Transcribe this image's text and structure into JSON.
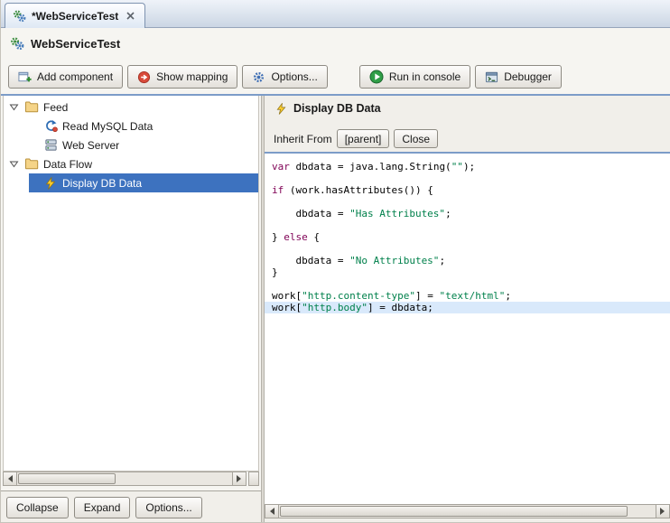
{
  "tab": {
    "title": "*WebServiceTest"
  },
  "header": {
    "title": "WebServiceTest"
  },
  "toolbar": {
    "buttons": [
      {
        "id": "add-component",
        "label": "Add component",
        "icon": "add-component-icon"
      },
      {
        "id": "show-mapping",
        "label": "Show mapping",
        "icon": "show-mapping-icon"
      },
      {
        "id": "options",
        "label": "Options...",
        "icon": "options-gear-icon"
      },
      {
        "id": "run-in-console",
        "label": "Run in console",
        "icon": "run-icon"
      },
      {
        "id": "debugger",
        "label": "Debugger",
        "icon": "debugger-icon"
      }
    ]
  },
  "tree": {
    "items": [
      {
        "label": "Feed",
        "icon": "folder-icon",
        "level": 0,
        "expanded": true
      },
      {
        "label": "Read MySQL Data",
        "icon": "mysql-data-icon",
        "level": 1
      },
      {
        "label": "Web Server",
        "icon": "web-server-icon",
        "level": 1
      },
      {
        "label": "Data Flow",
        "icon": "folder-icon",
        "level": 0,
        "expanded": true
      },
      {
        "label": "Display DB Data",
        "icon": "bolt-icon",
        "level": 1,
        "selected": true
      }
    ],
    "footer": {
      "collapse": "Collapse",
      "expand": "Expand",
      "options": "Options..."
    }
  },
  "editor": {
    "title": "Display DB Data",
    "icon": "bolt-icon",
    "inherit_label": "Inherit From",
    "parent_button": "[parent]",
    "close_button": "Close",
    "code": {
      "current_line": 12,
      "lines": [
        {
          "tokens": [
            {
              "t": "k",
              "v": "var"
            },
            {
              "t": "p",
              "v": " dbdata = java.lang.String("
            },
            {
              "t": "s",
              "v": "\"\""
            },
            {
              "t": "p",
              "v": ");"
            }
          ]
        },
        {
          "tokens": []
        },
        {
          "tokens": [
            {
              "t": "k",
              "v": "if"
            },
            {
              "t": "p",
              "v": " (work.hasAttributes()) {"
            }
          ]
        },
        {
          "tokens": []
        },
        {
          "tokens": [
            {
              "t": "p",
              "v": "    dbdata = "
            },
            {
              "t": "s",
              "v": "\"Has Attributes\""
            },
            {
              "t": "p",
              "v": ";"
            }
          ]
        },
        {
          "tokens": []
        },
        {
          "tokens": [
            {
              "t": "p",
              "v": "} "
            },
            {
              "t": "k",
              "v": "else"
            },
            {
              "t": "p",
              "v": " {"
            }
          ]
        },
        {
          "tokens": []
        },
        {
          "tokens": [
            {
              "t": "p",
              "v": "    dbdata = "
            },
            {
              "t": "s",
              "v": "\"No Attributes\""
            },
            {
              "t": "p",
              "v": ";"
            }
          ]
        },
        {
          "tokens": [
            {
              "t": "p",
              "v": "}"
            }
          ]
        },
        {
          "tokens": []
        },
        {
          "tokens": [
            {
              "t": "p",
              "v": "work["
            },
            {
              "t": "s",
              "v": "\"http.content-type\""
            },
            {
              "t": "p",
              "v": "] = "
            },
            {
              "t": "s",
              "v": "\"text/html\""
            },
            {
              "t": "p",
              "v": ";"
            }
          ]
        },
        {
          "tokens": [
            {
              "t": "p",
              "v": "work["
            },
            {
              "t": "s",
              "v": "\"http.body\""
            },
            {
              "t": "p",
              "v": "] = dbdata;"
            }
          ]
        }
      ]
    }
  },
  "colors": {
    "selection_blue": "#3D72BF",
    "separator_blue": "#7C9CC8",
    "code_keyword": "#7F0055",
    "code_string": "#00804B",
    "current_line_bg": "#D9E9FB",
    "run_green": "#2F9E47",
    "mapping_red": "#D84A3A",
    "bolt_yellow": "#FFCF2E"
  }
}
